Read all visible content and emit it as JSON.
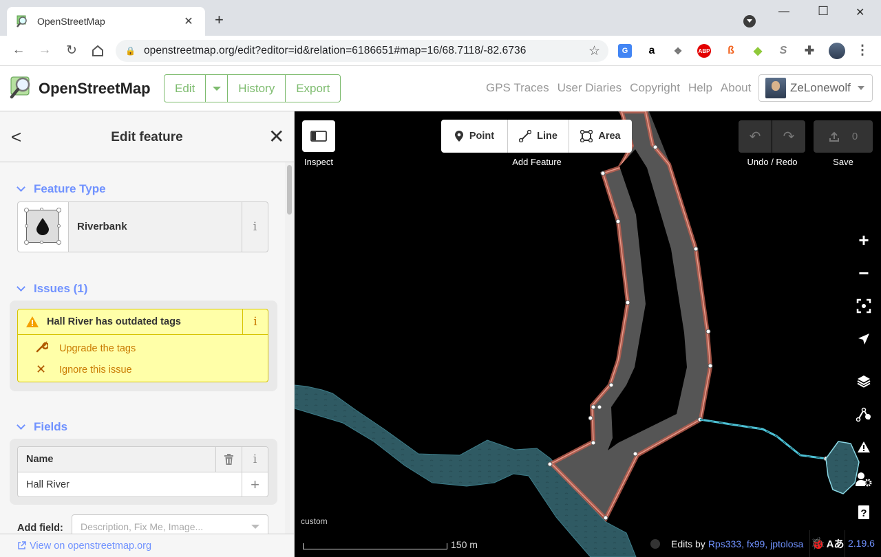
{
  "browser": {
    "tab_title": "OpenStreetMap",
    "url": "openstreetmap.org/edit?editor=id&relation=6186651#map=16/68.7118/-82.6736",
    "new_tab_symbol": "+",
    "minimize": "—",
    "maximize": "☐",
    "close": "✕"
  },
  "header": {
    "brand": "OpenStreetMap",
    "edit_label": "Edit",
    "history_label": "History",
    "export_label": "Export",
    "links": [
      "GPS Traces",
      "User Diaries",
      "Copyright",
      "Help",
      "About"
    ],
    "username": "ZeLonewolf"
  },
  "sidebar": {
    "title": "Edit feature",
    "back_symbol": "<",
    "close_symbol": "✕",
    "feature_type_section": "Feature Type",
    "feature_type": "Riverbank",
    "issues_section": "Issues (1)",
    "issue_message": "Hall River has outdated tags",
    "fix_upgrade": "Upgrade the tags",
    "fix_ignore": "Ignore this issue",
    "fields_section": "Fields",
    "field_name_label": "Name",
    "field_name_value": "Hall River",
    "add_field_label": "Add field:",
    "add_field_placeholder": "Description, Fix Me, Image...",
    "view_on_osm": "View on openstreetmap.org",
    "info_symbol": "i"
  },
  "map": {
    "inspect_label": "Inspect",
    "add_feature_label": "Add Feature",
    "mode_point": "Point",
    "mode_line": "Line",
    "mode_area": "Area",
    "undo_redo_label": "Undo / Redo",
    "save_label": "Save",
    "save_count": "0",
    "zoom_in": "+",
    "zoom_out": "−",
    "custom_label": "custom",
    "scale_text": "150 m",
    "edits_by_prefix": "Edits by ",
    "edits_by_users": "Rps333, fx99, jptolosa",
    "version": "2.19.6"
  },
  "colors": {
    "osm_green": "#7ebc6f",
    "link_blue": "#7092ff",
    "issue_yellow": "#ffffa8",
    "water_teal": "#2f5a63",
    "selected_red": "#e06e5f"
  }
}
